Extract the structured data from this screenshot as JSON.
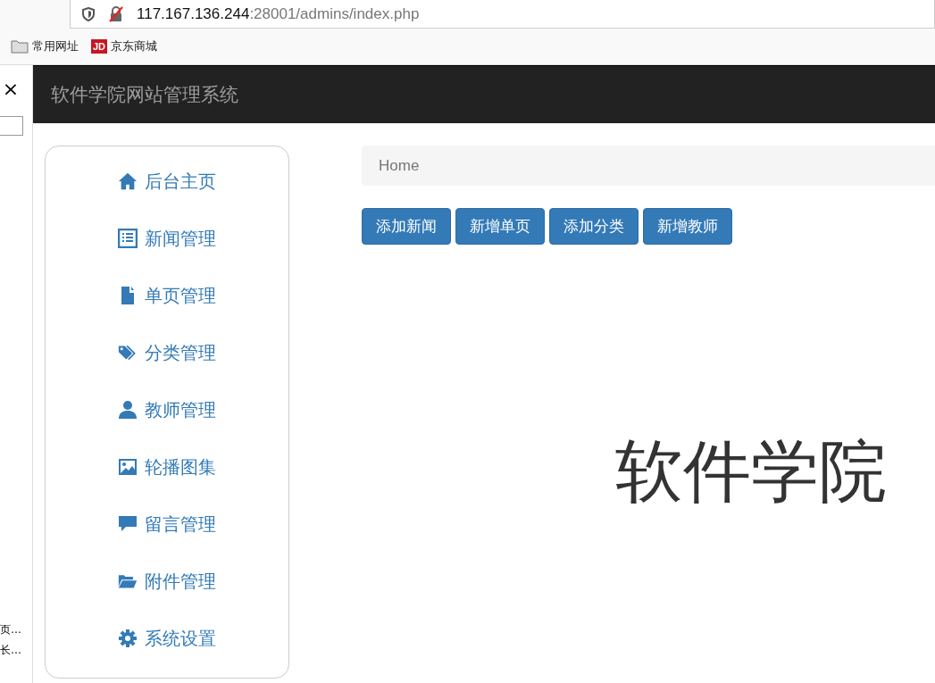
{
  "browser": {
    "url_host": "117.167.136.244",
    "url_rest": ":28001/admins/index.php",
    "bookmarks": [
      {
        "label": "常用网址",
        "kind": "folder"
      },
      {
        "label": "京东商城",
        "kind": "jd"
      }
    ],
    "jd_logo": "JD"
  },
  "side_panel": {
    "close": "×",
    "items": [
      "页…",
      "长…"
    ]
  },
  "navbar": {
    "brand": "软件学院网站管理系统"
  },
  "sidebar": {
    "items": [
      {
        "label": "后台主页"
      },
      {
        "label": "新闻管理"
      },
      {
        "label": "单页管理"
      },
      {
        "label": "分类管理"
      },
      {
        "label": "教师管理"
      },
      {
        "label": "轮播图集"
      },
      {
        "label": "留言管理"
      },
      {
        "label": "附件管理"
      },
      {
        "label": "系统设置"
      }
    ]
  },
  "breadcrumb": [
    "Home"
  ],
  "buttons": [
    "添加新闻",
    "新增单页",
    "添加分类",
    "新增教师"
  ],
  "heading": "软件学院"
}
